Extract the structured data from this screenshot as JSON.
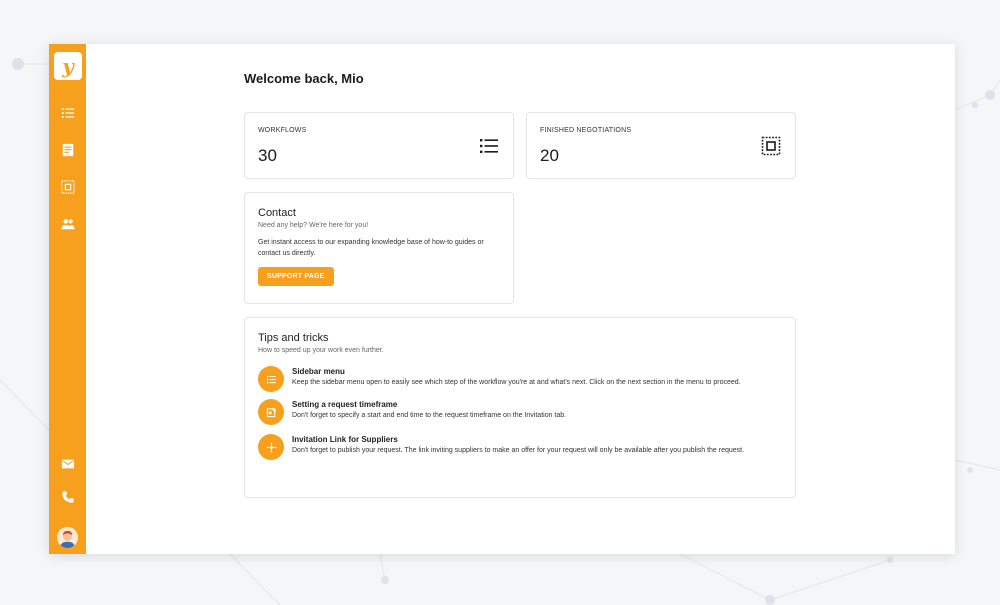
{
  "sidebar": {
    "logo_text": "y",
    "nav_icons": [
      "list-icon",
      "document-icon",
      "selection-icon",
      "people-icon"
    ],
    "bottom_icons": [
      "mail-icon",
      "phone-icon"
    ],
    "accent_color": "#f7a01e"
  },
  "header": {
    "welcome": "Welcome back, Mio"
  },
  "stats": [
    {
      "label": "WORKFLOWS",
      "value": "30",
      "icon": "list-icon"
    },
    {
      "label": "FINISHED NEGOTIATIONS",
      "value": "20",
      "icon": "selection-icon"
    }
  ],
  "contact": {
    "title": "Contact",
    "subtitle": "Need any help? We're here for you!",
    "text": "Get instant access to our expanding knowledge base of how-to guides or contact us directly.",
    "button_label": "SUPPORT PAGE"
  },
  "tips": {
    "title": "Tips and tricks",
    "subtitle": "How to speed up your work even further.",
    "items": [
      {
        "icon": "list-icon",
        "title": "Sidebar menu",
        "text": "Keep the sidebar menu open to easily see which step of the workflow you're at and what's next. Click on the next section in the menu to proceed."
      },
      {
        "icon": "calendar-edit-icon",
        "title": "Setting a request timeframe",
        "text": "Don't forget to specify a start and end time to the request timeframe on the Invitation tab."
      },
      {
        "icon": "link-network-icon",
        "title": "Invitation Link for Suppliers",
        "text": "Don't forget to publish your request. The link inviting suppliers to make an offer for your request will only be available after you publish the request."
      }
    ]
  }
}
